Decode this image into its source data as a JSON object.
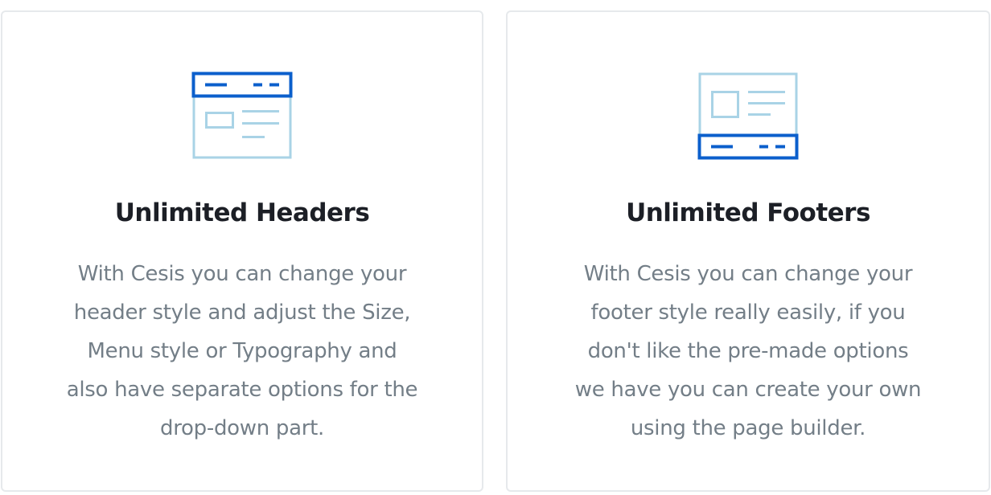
{
  "colors": {
    "icon_primary": "#0b5fcc",
    "icon_secondary": "#a9d3e6",
    "title": "#1c1f26",
    "body_text": "#737e87",
    "card_border": "#e6e9ec"
  },
  "cards": [
    {
      "icon": "header-layout-icon",
      "title": "Unlimited Headers",
      "description_lines": [
        "With Cesis you can change your",
        "header style and adjust the Size,",
        "Menu style or Typography and",
        "also have separate options for the",
        "drop-down part."
      ]
    },
    {
      "icon": "footer-layout-icon",
      "title": "Unlimited Footers",
      "description_lines": [
        "With Cesis you can change your",
        "footer style really easily, if you",
        "don't like the pre-made options",
        "we have you can create your own",
        "using the page builder."
      ]
    }
  ]
}
